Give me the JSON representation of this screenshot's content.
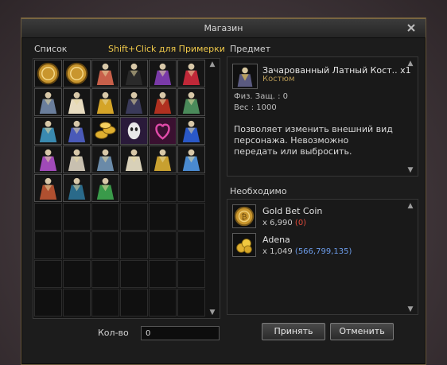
{
  "window": {
    "title": "Магазин"
  },
  "list": {
    "label": "Список",
    "hint": "Shift+Click для Примерки",
    "items": [
      {
        "icon": "gold-coin-icon",
        "color": "#c9962e"
      },
      {
        "icon": "gold-coin-icon",
        "color": "#c9962e"
      },
      {
        "icon": "costume-icon",
        "color": "#c8604a"
      },
      {
        "icon": "costume-icon",
        "color": "#2a2a2a"
      },
      {
        "icon": "costume-icon",
        "color": "#7a3aa8"
      },
      {
        "icon": "costume-icon",
        "color": "#c02838"
      },
      {
        "icon": "costume-icon",
        "color": "#6a7e9c"
      },
      {
        "icon": "costume-icon",
        "color": "#e8dcc0"
      },
      {
        "icon": "costume-icon",
        "color": "#d4a428"
      },
      {
        "icon": "costume-icon",
        "color": "#3a3a5a"
      },
      {
        "icon": "costume-icon",
        "color": "#b03020"
      },
      {
        "icon": "costume-icon",
        "color": "#4a8a5a"
      },
      {
        "icon": "costume-icon",
        "color": "#3a8ab0"
      },
      {
        "icon": "costume-icon",
        "color": "#4a5ab8"
      },
      {
        "icon": "gold-coins-icon",
        "color": "#e0b030"
      },
      {
        "icon": "mask-icon",
        "color": "#e8e8e8"
      },
      {
        "icon": "heart-icon",
        "color": "#e04aa8"
      },
      {
        "icon": "costume-icon",
        "color": "#2a58c8"
      },
      {
        "icon": "costume-icon",
        "color": "#a04ab8"
      },
      {
        "icon": "costume-icon",
        "color": "#c8c0b0"
      },
      {
        "icon": "costume-icon",
        "color": "#6a8aa8"
      },
      {
        "icon": "costume-icon",
        "color": "#d8d0b8"
      },
      {
        "icon": "costume-icon",
        "color": "#c8a030"
      },
      {
        "icon": "costume-icon",
        "color": "#4a8ad0"
      },
      {
        "icon": "costume-icon",
        "color": "#b05030"
      },
      {
        "icon": "costume-icon",
        "color": "#2a6a8a"
      },
      {
        "icon": "costume-icon",
        "color": "#3a9a4a"
      }
    ]
  },
  "item": {
    "label": "Предмет",
    "name": "Зачарованный Латный Кост.. x1",
    "type": "Костюм",
    "def": "Физ. Защ. : 0",
    "weight": "Вес : 1000",
    "description": "Позволяет изменить внешний вид персонажа. Невозможно передать или выбросить.",
    "icon": "costume-icon",
    "icon_color": "#5a5a80"
  },
  "required": {
    "label": "Необходимо",
    "items": [
      {
        "name": "Gold Bet Coin",
        "qty": "x 6,990",
        "owned": "(0)",
        "owned_color": "#e04a3a",
        "icon": "gold-coin-icon"
      },
      {
        "name": "Adena",
        "qty": "x 1,049",
        "owned": "(566,799,135)",
        "owned_color": "#6c9cea",
        "icon": "adena-icon"
      }
    ]
  },
  "quantity": {
    "label": "Кол-во",
    "value": "0"
  },
  "buttons": {
    "accept": "Принять",
    "cancel": "Отменить"
  },
  "colors": {
    "accent_gold": "#f0c94a",
    "frame": "#6a5a3c"
  }
}
